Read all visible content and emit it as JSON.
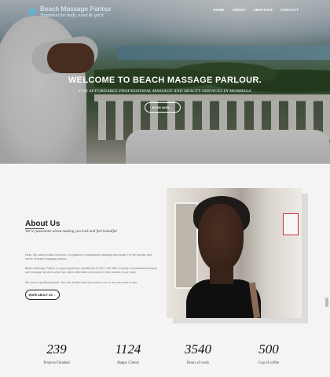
{
  "header": {
    "logo_title": "Beach Massage Parlour",
    "logo_tagline": "Treatment for body, mind & spirit",
    "nav": [
      "HOME",
      "ABOUT",
      "SERVICES",
      "CONTACT"
    ]
  },
  "hero": {
    "title": "WELCOME TO BEACH MASSAGE PARLOUR.",
    "subtitle": "FOR AFFORDABLE PROFESSIONAL MASSAGE AND BEAUTY SERVICES IN MOMBASA",
    "button": "BOOK NOW →"
  },
  "about": {
    "title": "About Us",
    "subtitle": "We're passionate about making you look and feel beautiful",
    "paragraphs": [
      "Hello. My name is Alice Kemunto, a registered, professional massage and model. I'm the founder and owner of beach massage parlour.",
      "Beach Massage Parlour is a growing brand, established in 2017. We offer a variety of professional beauty and massage services which are rather affordable compared to other brands in our niche.",
      "We source quality products. You can decide book and come to us, or we can come to you."
    ],
    "button": "MORE ABOUT US →"
  },
  "stats": [
    {
      "value": "239",
      "label": "Projects Finished"
    },
    {
      "value": "1124",
      "label": "Happy Clients"
    },
    {
      "value": "3540",
      "label": "Hours of work"
    },
    {
      "value": "500",
      "label": "Cup of coffee"
    }
  ],
  "colors": {
    "accent": "#3aa8e0",
    "dark": "#222222"
  }
}
